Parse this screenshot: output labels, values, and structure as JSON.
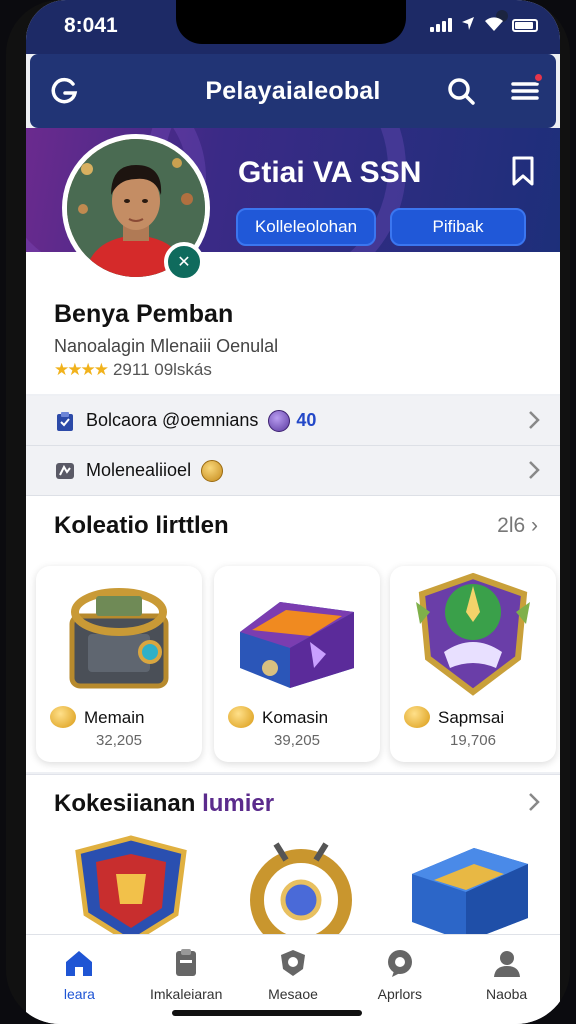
{
  "status_bar": {
    "time": "8:041"
  },
  "header": {
    "title": "Pelayaialeobal"
  },
  "banner": {
    "title": "Gtiai VA SSN",
    "buttons": [
      "Kolleleolohan",
      "Pifibak"
    ]
  },
  "profile": {
    "name": "Benya Pemban",
    "subtitle": "Nanoalagin Mlenaiii Oenulal",
    "stars": "★★★★",
    "rating_text": "2911 09lskás"
  },
  "rows": [
    {
      "label": "Bolcaora @oemnians",
      "value": "40",
      "icon": "clipboard-icon",
      "coin": "purple-coin-icon"
    },
    {
      "label": "Molenealiioel",
      "value": "",
      "icon": "map-icon",
      "coin": "gold-coin-icon"
    }
  ],
  "section1": {
    "title": "Koleatio lirttlen",
    "count": "2l6",
    "cards": [
      {
        "label": "Memain",
        "value": "32,205",
        "art": "treasure-chest"
      },
      {
        "label": "Komasin",
        "value": "39,205",
        "art": "magic-crate"
      },
      {
        "label": "Sapmsai",
        "value": "19,706",
        "art": "guild-shield"
      }
    ]
  },
  "section2": {
    "title": "Kokesiianan",
    "title_accent": "lumier",
    "items": [
      "crest-shield",
      "golden-amulet",
      "blue-treasure-box"
    ]
  },
  "bottom_nav": [
    {
      "label": "leara",
      "icon": "home-icon",
      "active": true
    },
    {
      "label": "Imkaleiaran",
      "icon": "clipboard-icon",
      "active": false
    },
    {
      "label": "Mesaoe",
      "icon": "shield-icon",
      "active": false
    },
    {
      "label": "Aprlors",
      "icon": "chat-icon",
      "active": false
    },
    {
      "label": "Naoba",
      "icon": "user-icon",
      "active": false
    }
  ],
  "colors": {
    "header": "#213475",
    "accent_blue": "#2058d8",
    "active_nav": "#1f55d4",
    "notification": "#e6354b"
  }
}
